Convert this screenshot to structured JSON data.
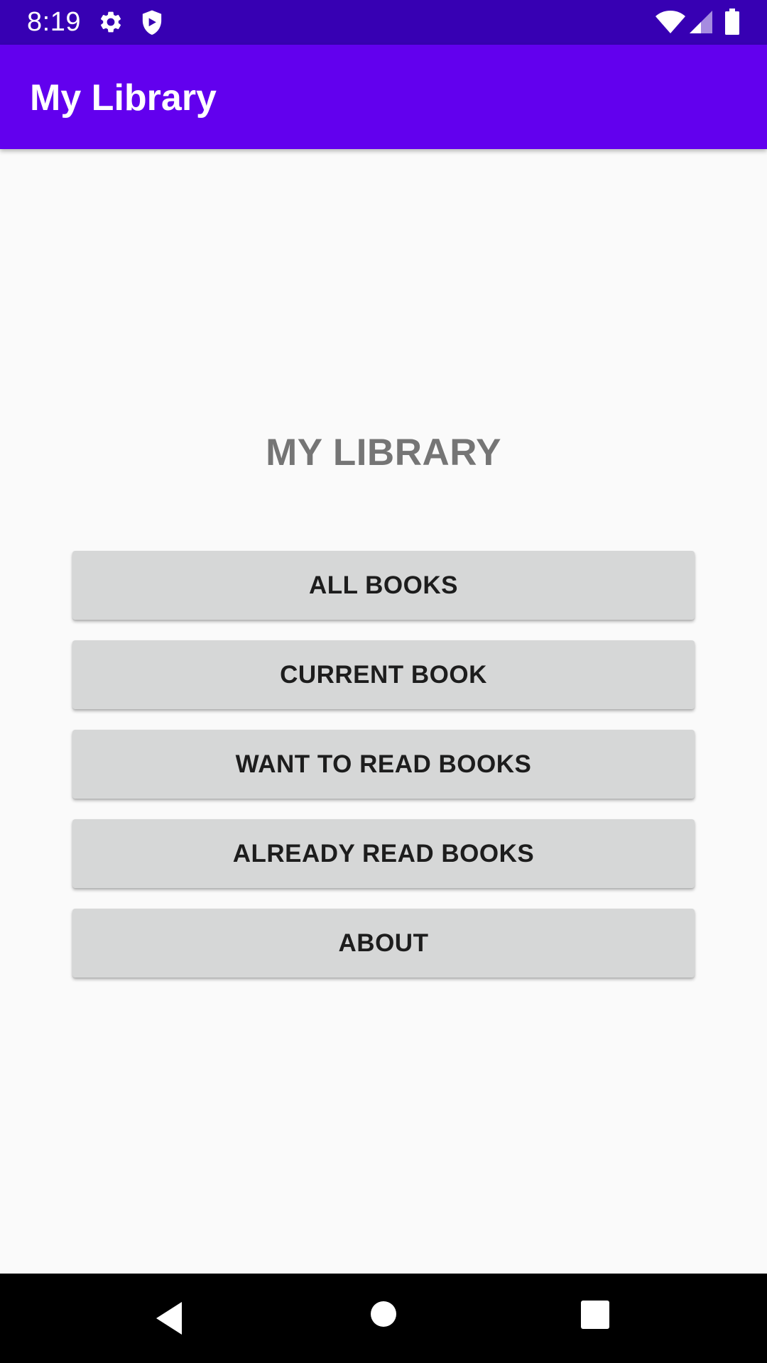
{
  "status_bar": {
    "time": "8:19",
    "icons": [
      "gear-icon",
      "shield-icon",
      "wifi-icon",
      "signal-icon",
      "battery-icon"
    ]
  },
  "app_bar": {
    "title": "My Library"
  },
  "main": {
    "heading": "MY LIBRARY",
    "buttons": [
      {
        "label": "ALL BOOKS"
      },
      {
        "label": "CURRENT BOOK"
      },
      {
        "label": "WANT TO READ BOOKS"
      },
      {
        "label": "ALREADY READ BOOKS"
      },
      {
        "label": "ABOUT"
      }
    ]
  },
  "navigation_bar": {
    "icons": [
      "back-icon",
      "home-icon",
      "recents-icon"
    ]
  },
  "colors": {
    "status_bar": "#3700b3",
    "app_bar": "#6200ee",
    "background": "#fafafa",
    "button": "#d6d7d7",
    "heading_text": "#757575",
    "button_text": "#1d1d1d"
  }
}
